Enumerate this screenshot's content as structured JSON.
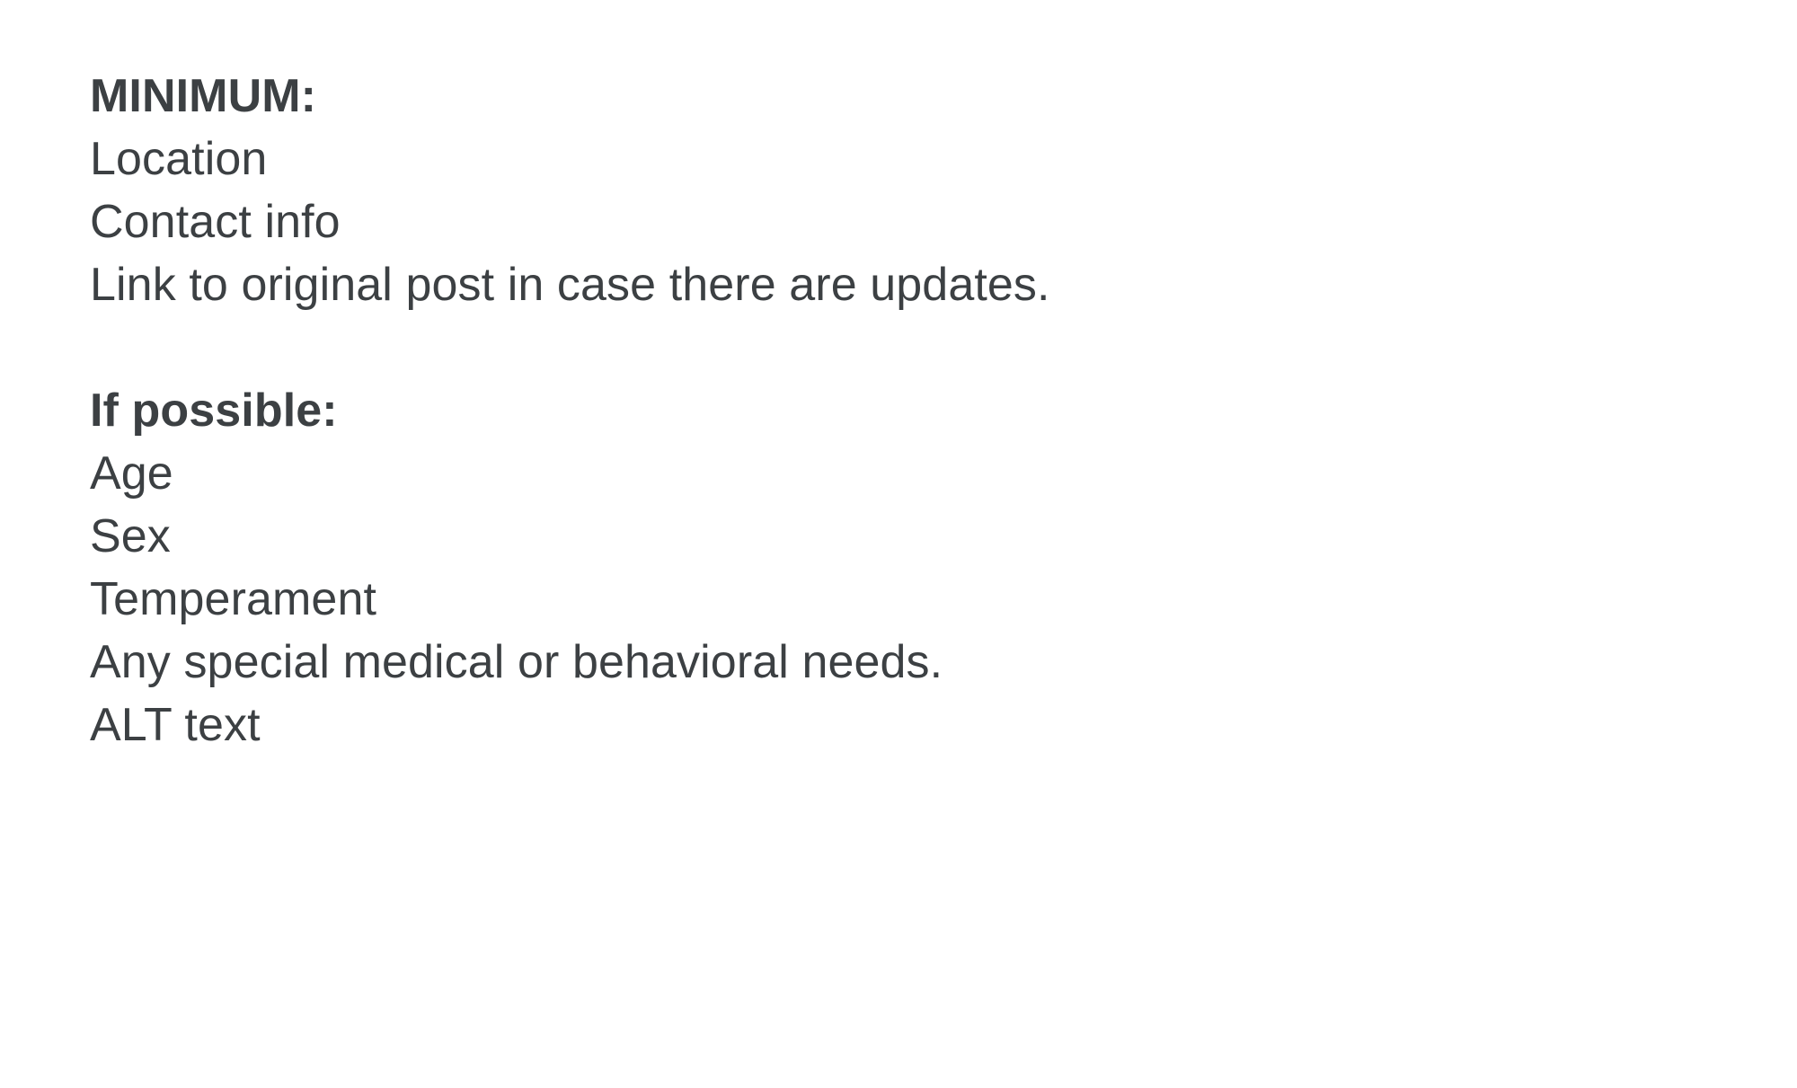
{
  "document": {
    "background_color": "#ffffff",
    "text_color": "#3c4043",
    "edge_strip_color": "#e8eaed",
    "blocks": [
      {
        "heading": "MINIMUM:",
        "lines": [
          "Location",
          "Contact info",
          "Link to original post in case there are updates."
        ]
      },
      {
        "heading": "If possible:",
        "lines": [
          "Age",
          "Sex",
          "Temperament",
          "Any special medical or behavioral needs.",
          "ALT text"
        ]
      }
    ]
  }
}
